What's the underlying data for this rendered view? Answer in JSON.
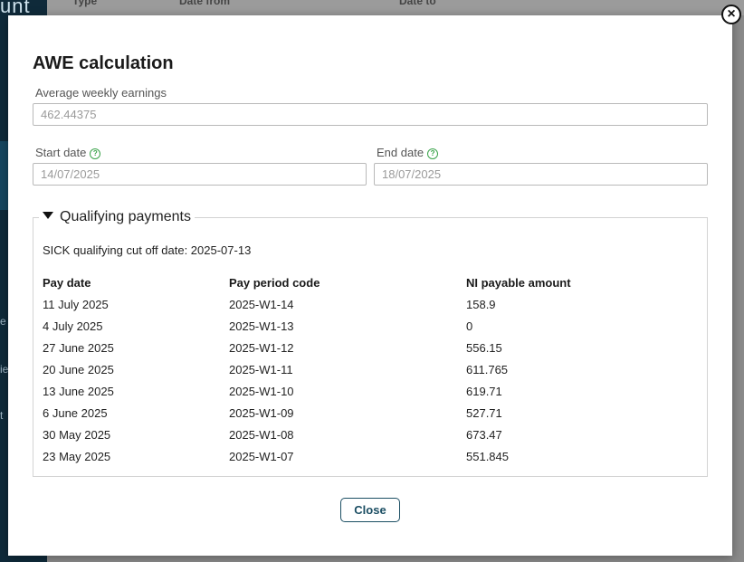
{
  "background": {
    "brand_fragment": "unt",
    "sidebar_fragments": [
      "e",
      "ie",
      "t"
    ],
    "header_columns": [
      "Type",
      "Date from",
      "Date to"
    ]
  },
  "modal": {
    "title": "AWE calculation",
    "close_icon": "close-icon",
    "average_weekly_earnings": {
      "label": "Average weekly earnings",
      "value": "462.44375"
    },
    "start_date": {
      "label": "Start date",
      "value": "14/07/2025",
      "help_icon": "?"
    },
    "end_date": {
      "label": "End date",
      "value": "18/07/2025",
      "help_icon": "?"
    },
    "qualifying_payments": {
      "legend": "Qualifying payments",
      "cutoff_text": "SICK qualifying cut off date: 2025-07-13",
      "columns": [
        "Pay date",
        "Pay period code",
        "NI payable amount"
      ],
      "rows": [
        [
          "11 July 2025",
          "2025-W1-14",
          "158.9"
        ],
        [
          "4 July 2025",
          "2025-W1-13",
          "0"
        ],
        [
          "27 June 2025",
          "2025-W1-12",
          "556.15"
        ],
        [
          "20 June 2025",
          "2025-W1-11",
          "611.765"
        ],
        [
          "13 June 2025",
          "2025-W1-10",
          "619.71"
        ],
        [
          "6 June 2025",
          "2025-W1-09",
          "527.71"
        ],
        [
          "30 May 2025",
          "2025-W1-08",
          "673.47"
        ],
        [
          "23 May 2025",
          "2025-W1-07",
          "551.845"
        ]
      ]
    },
    "close_button": "Close"
  },
  "colors": {
    "accent": "#1b4e63",
    "help": "#3aa34a",
    "sidebar": "#0f2a3a"
  }
}
